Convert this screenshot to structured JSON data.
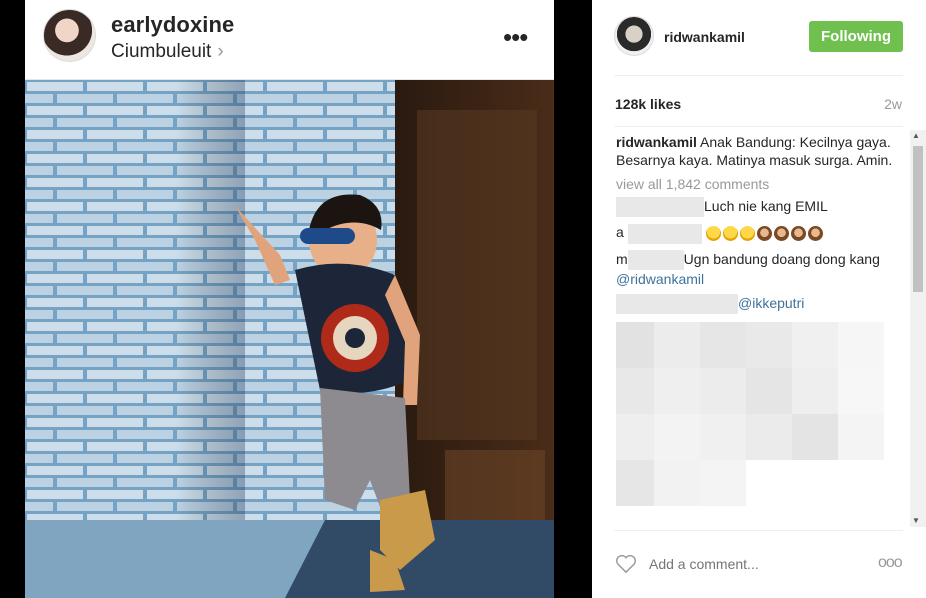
{
  "post": {
    "username": "earlydoxine",
    "location": "Ciumbuleuit",
    "more_label": "•••"
  },
  "side": {
    "username": "ridwankamil",
    "follow_label": "Following",
    "likes": "128k likes",
    "age": "2w",
    "caption_user": "ridwankamil",
    "caption_text": " Anak Bandung: Kecilnya gaya. Besarnya kaya. Matinya masuk surga. Amin.",
    "view_all": "view all 1,842 comments",
    "comments": [
      {
        "text": "Luch nie kang EMIL"
      },
      {
        "text": "a"
      },
      {
        "text_a": "m",
        "text_b": "Ugn bandung doang dong kang ",
        "mention": "@ridwankamil"
      },
      {
        "mention": "@ikkeputri"
      }
    ],
    "add_comment_placeholder": "Add a comment...",
    "more_label": "ooo"
  },
  "colors": {
    "follow_green": "#70c050",
    "mention_blue": "#3f729b"
  },
  "icons": [
    "more-dots-icon",
    "chevron-right-icon",
    "heart-icon",
    "options-icon"
  ]
}
